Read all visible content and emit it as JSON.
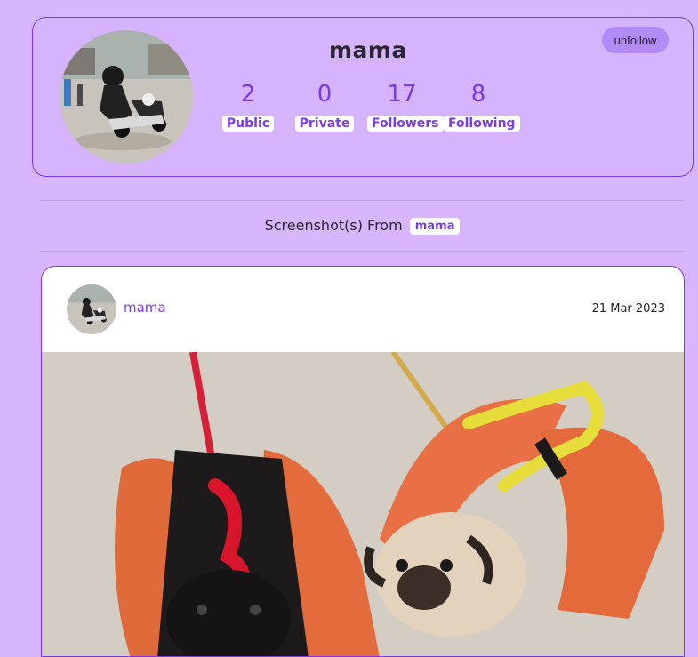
{
  "profile": {
    "username": "mama",
    "unfollow_label": "unfollow",
    "stats": [
      {
        "value": "2",
        "label": "Public"
      },
      {
        "value": "0",
        "label": "Private"
      },
      {
        "value": "17",
        "label": "Followers"
      },
      {
        "value": "8",
        "label": "Following"
      }
    ]
  },
  "section": {
    "heading": "Screenshot(s) From",
    "owner": "mama"
  },
  "post": {
    "author": "mama",
    "date": "21 Mar 2023"
  },
  "colors": {
    "background": "#d8b6fd",
    "accent": "#7c3aed",
    "button": "#b28bf6"
  }
}
